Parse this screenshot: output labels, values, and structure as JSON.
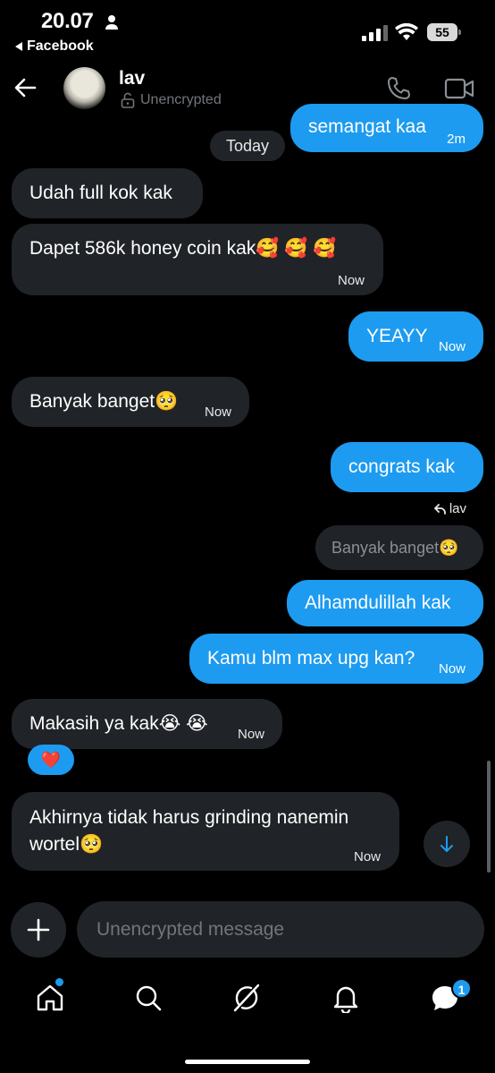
{
  "status_bar": {
    "time": "20.07",
    "back_app": "Facebook",
    "battery": "55"
  },
  "header": {
    "name": "lav",
    "encryption": "Unencrypted"
  },
  "date_separator": "Today",
  "messages": [
    {
      "text": "semangat kaa",
      "time": "2m",
      "side": "out"
    },
    {
      "text": "Udah full kok kak",
      "time": "",
      "side": "in"
    },
    {
      "text": "Dapet 586k honey coin kak🥰 🥰 🥰",
      "time": "Now",
      "side": "in"
    },
    {
      "text": "YEAYY",
      "time": "Now",
      "side": "out"
    },
    {
      "text": "Banyak banget🥺",
      "time": "Now",
      "side": "in"
    },
    {
      "text": "congrats kak",
      "time": "",
      "side": "out"
    },
    {
      "text": "Alhamdulillah kak",
      "time": "",
      "side": "out"
    },
    {
      "text": "Kamu blm max upg kan?",
      "time": "Now",
      "side": "out"
    },
    {
      "text": "Makasih ya kak😭 😭",
      "time": "Now",
      "side": "in"
    },
    {
      "text": "Akhirnya tidak harus grinding nanemin",
      "text2": "wortel🥺",
      "time": "Now",
      "side": "in"
    }
  ],
  "reply": {
    "to": "lav",
    "quoted_text": "Banyak banget🥺"
  },
  "reaction": "❤️",
  "composer": {
    "placeholder": "Unencrypted message"
  },
  "tabs": [
    {
      "name": "home",
      "icon": "home-icon",
      "has_dot": true
    },
    {
      "name": "search",
      "icon": "search-icon"
    },
    {
      "name": "grok",
      "icon": "grok-icon"
    },
    {
      "name": "notifications",
      "icon": "bell-icon"
    },
    {
      "name": "messages",
      "icon": "messages-icon",
      "badge": "1"
    }
  ],
  "colors": {
    "accent": "#1d9bf0",
    "incoming_bubble": "#202327",
    "background": "#000000"
  }
}
